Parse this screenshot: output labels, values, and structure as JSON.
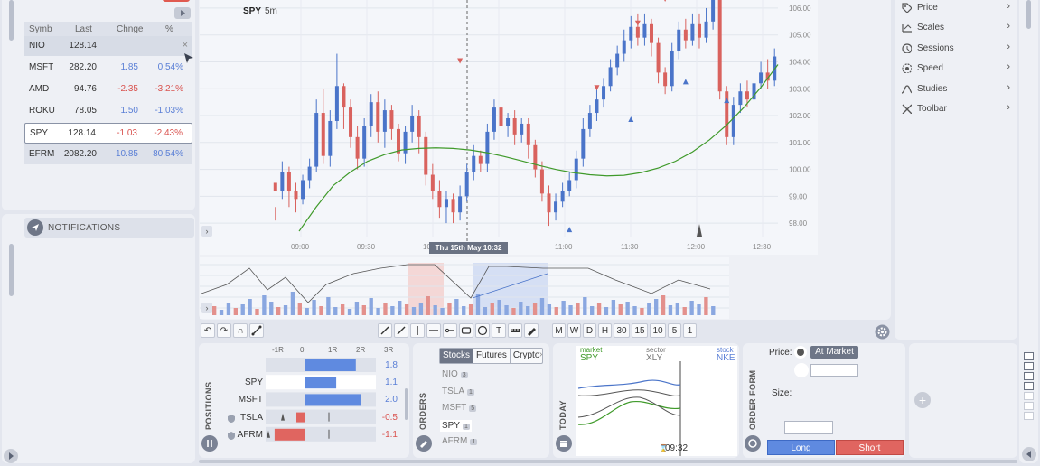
{
  "watchlist": {
    "headers": {
      "symbol": "Symb",
      "last": "Last",
      "change": "Chnge",
      "pct": "%"
    },
    "rows": [
      {
        "symbol": "NIO",
        "last": "128.14",
        "change": "",
        "pct": "",
        "close": "×"
      },
      {
        "symbol": "MSFT",
        "last": "282.20",
        "change": "1.85",
        "pct": "0.54%"
      },
      {
        "symbol": "AMD",
        "last": "94.76",
        "change": "-2.35",
        "pct": "-3.21%"
      },
      {
        "symbol": "ROKU",
        "last": "78.05",
        "change": "1.50",
        "pct": "-1.03%"
      },
      {
        "symbol": "SPY",
        "last": "128.14",
        "change": "-1.03",
        "pct": "-2.43%"
      },
      {
        "symbol": "EFRM",
        "last": "2082.20",
        "change": "10.85",
        "pct": "80.54%"
      }
    ]
  },
  "notifications": {
    "title": "NOTIFICATIONS"
  },
  "chart": {
    "symbol": "SPY",
    "interval": "5m",
    "crosshair_label": "Thu 15th May 10:32",
    "y_ticks": [
      "106.00",
      "105.00",
      "104.00",
      "103.00",
      "102.00",
      "101.00",
      "100.00",
      "99.00",
      "98.00"
    ],
    "x_ticks": [
      "09:00",
      "09:30",
      "10:00",
      "10:30",
      "11:00",
      "11:30",
      "12:00",
      "12:30"
    ],
    "colors": {
      "up": "#4a74c9",
      "down": "#d9625e",
      "ma": "#3f9a2a"
    }
  },
  "chart_data": {
    "type": "candlestick",
    "ylim": [
      97.5,
      106.3
    ],
    "candles": [
      [
        99.5,
        99.2,
        98.6,
        98.1
      ],
      [
        99.2,
        99.9,
        100.3,
        98.9
      ],
      [
        99.9,
        99.2,
        100.1,
        98.6
      ],
      [
        99.2,
        98.9,
        99.5,
        98.4
      ],
      [
        98.9,
        99.6,
        99.8,
        98.7
      ],
      [
        99.6,
        100.1,
        100.4,
        99.3
      ],
      [
        100.1,
        102.1,
        102.6,
        99.9
      ],
      [
        102.1,
        100.5,
        103.0,
        100.2
      ],
      [
        100.5,
        101.8,
        102.2,
        100.1
      ],
      [
        101.8,
        103.1,
        104.3,
        101.5
      ],
      [
        103.1,
        102.3,
        103.2,
        101.5
      ],
      [
        102.3,
        101.2,
        102.6,
        100.8
      ],
      [
        101.2,
        100.4,
        101.6,
        100.0
      ],
      [
        100.4,
        101.6,
        101.9,
        100.1
      ],
      [
        101.6,
        102.5,
        102.8,
        101.2
      ],
      [
        102.5,
        101.4,
        102.9,
        101.0
      ],
      [
        101.4,
        102.2,
        102.6,
        100.8
      ],
      [
        102.2,
        101.5,
        102.4,
        101.1
      ],
      [
        101.5,
        100.6,
        101.7,
        100.3
      ],
      [
        100.6,
        101.4,
        101.6,
        100.2
      ],
      [
        101.4,
        102.0,
        102.4,
        101.0
      ],
      [
        102.0,
        101.2,
        102.2,
        100.6
      ],
      [
        101.2,
        99.8,
        101.4,
        99.4
      ],
      [
        99.8,
        99.2,
        100.2,
        98.9
      ],
      [
        99.2,
        98.6,
        99.6,
        98.2
      ],
      [
        98.6,
        98.9,
        99.2,
        98.0
      ],
      [
        98.9,
        98.4,
        99.1,
        98.0
      ],
      [
        98.4,
        99.0,
        99.4,
        98.1
      ],
      [
        99.0,
        99.9,
        100.2,
        98.8
      ],
      [
        99.9,
        100.5,
        100.9,
        99.6
      ],
      [
        100.5,
        100.2,
        100.7,
        99.9
      ],
      [
        100.2,
        101.4,
        101.7,
        99.9
      ],
      [
        101.4,
        102.3,
        102.6,
        101.1
      ],
      [
        102.3,
        101.6,
        103.2,
        101.2
      ],
      [
        101.6,
        101.9,
        102.1,
        101.2
      ],
      [
        101.9,
        101.3,
        102.2,
        100.9
      ],
      [
        101.3,
        101.7,
        101.9,
        101.0
      ],
      [
        101.7,
        100.9,
        101.9,
        100.4
      ],
      [
        100.9,
        100.0,
        101.1,
        99.7
      ],
      [
        100.0,
        99.1,
        100.3,
        98.8
      ],
      [
        99.1,
        98.4,
        99.4,
        97.9
      ],
      [
        98.4,
        98.8,
        99.1,
        98.1
      ],
      [
        98.8,
        99.2,
        99.5,
        98.6
      ],
      [
        99.2,
        99.6,
        99.9,
        99.0
      ],
      [
        99.6,
        100.4,
        100.7,
        99.3
      ],
      [
        100.4,
        101.5,
        101.9,
        100.1
      ],
      [
        101.5,
        102.1,
        102.4,
        101.2
      ],
      [
        102.1,
        102.6,
        103.0,
        101.8
      ],
      [
        102.6,
        103.1,
        103.4,
        102.3
      ],
      [
        103.1,
        103.8,
        104.1,
        102.9
      ],
      [
        103.8,
        104.3,
        104.6,
        103.5
      ],
      [
        104.3,
        104.8,
        105.2,
        104.0
      ],
      [
        104.8,
        105.3,
        105.7,
        104.5
      ],
      [
        105.3,
        104.9,
        105.8,
        104.6
      ],
      [
        104.9,
        105.4,
        105.8,
        104.6
      ],
      [
        105.4,
        104.7,
        105.6,
        104.2
      ],
      [
        104.7,
        103.6,
        104.9,
        103.2
      ],
      [
        103.6,
        103.1,
        103.8,
        102.8
      ],
      [
        103.1,
        104.4,
        104.7,
        102.9
      ],
      [
        104.4,
        105.2,
        105.5,
        104.1
      ],
      [
        105.2,
        104.8,
        105.6,
        104.5
      ],
      [
        104.8,
        105.4,
        105.8,
        104.6
      ],
      [
        105.4,
        104.9,
        105.8,
        104.5
      ],
      [
        104.9,
        105.5,
        106.0,
        104.7
      ],
      [
        105.5,
        106.3,
        106.4,
        105.2
      ],
      [
        106.3,
        102.9,
        106.4,
        102.6
      ],
      [
        102.9,
        101.2,
        103.1,
        100.9
      ],
      [
        101.2,
        102.4,
        102.7,
        100.9
      ],
      [
        102.4,
        102.9,
        103.2,
        102.1
      ],
      [
        102.9,
        102.6,
        103.3,
        102.3
      ],
      [
        102.6,
        103.2,
        103.6,
        102.4
      ],
      [
        103.2,
        103.6,
        104.0,
        103.0
      ],
      [
        103.6,
        103.3,
        104.1,
        103.0
      ],
      [
        103.3,
        104.2,
        104.5,
        103.1
      ]
    ],
    "ma": [
      97.7,
      98.6,
      99.4,
      99.9,
      100.3,
      100.55,
      100.72,
      100.78,
      100.8,
      100.78,
      100.72,
      100.62,
      100.48,
      100.32,
      100.15,
      100.0,
      99.88,
      99.8,
      99.76,
      99.78,
      99.88,
      100.05,
      100.3,
      100.65,
      101.1,
      101.65,
      102.3,
      103.05,
      103.9
    ],
    "markers_up": [
      [
        43,
        97.8
      ],
      [
        52,
        101.9
      ],
      [
        60,
        103.3
      ],
      [
        66,
        102.6
      ]
    ],
    "markers_down": [
      [
        27,
        104.0
      ],
      [
        47,
        103.0
      ],
      [
        57,
        106.3
      ],
      [
        53,
        105.4
      ]
    ]
  },
  "drawing_tools": {
    "undo": "↶",
    "redo": "↷",
    "magnet": "∩",
    "text_tool": "T",
    "timeframes": [
      "M",
      "W",
      "D",
      "H",
      "30",
      "15",
      "10",
      "5",
      "1"
    ]
  },
  "menu": {
    "items": [
      {
        "label": "Price",
        "icon": "price-tag-icon"
      },
      {
        "label": "Scales",
        "icon": "scales-icon"
      },
      {
        "label": "Sessions",
        "icon": "sessions-icon"
      },
      {
        "label": "Speed",
        "icon": "speed-icon"
      },
      {
        "label": "Studies",
        "icon": "studies-icon"
      },
      {
        "label": "Toolbar",
        "icon": "toolbar-icon"
      }
    ]
  },
  "positions": {
    "title": "POSITIONS",
    "scale": [
      "-1R",
      "0",
      "1R",
      "2R",
      "3R"
    ],
    "rows": [
      {
        "symbol": "",
        "value": "1.8",
        "rvalue": 1.8
      },
      {
        "symbol": "SPY",
        "value": "1.1",
        "rvalue": 1.1
      },
      {
        "symbol": "MSFT",
        "value": "2.0",
        "rvalue": 2.0
      },
      {
        "symbol": "TSLA",
        "value": "-0.5",
        "rvalue": -0.5
      },
      {
        "symbol": "AFRM",
        "value": "-1.1",
        "rvalue": -1.1
      }
    ]
  },
  "orders": {
    "title": "ORDERS",
    "tabs": [
      "Stocks",
      "Futures",
      "Crypto"
    ],
    "rows": [
      {
        "symbol": "NIO",
        "count": "3"
      },
      {
        "symbol": "TSLA",
        "count": "1"
      },
      {
        "symbol": "MSFT",
        "count": "5"
      },
      {
        "symbol": "SPY",
        "count": "1"
      },
      {
        "symbol": "AFRM",
        "count": "1"
      }
    ]
  },
  "today": {
    "title": "TODAY",
    "market_label": "market",
    "market_value": "SPY",
    "sector_label": "sector",
    "sector_value": "XLY",
    "stock_label": "stock",
    "stock_value": "NKE",
    "time": "09:32"
  },
  "order_form": {
    "title": "ORDER FORM",
    "price_label": "Price:",
    "at_market": "At Market",
    "size_label": "Size:",
    "long": "Long",
    "short": "Short"
  }
}
